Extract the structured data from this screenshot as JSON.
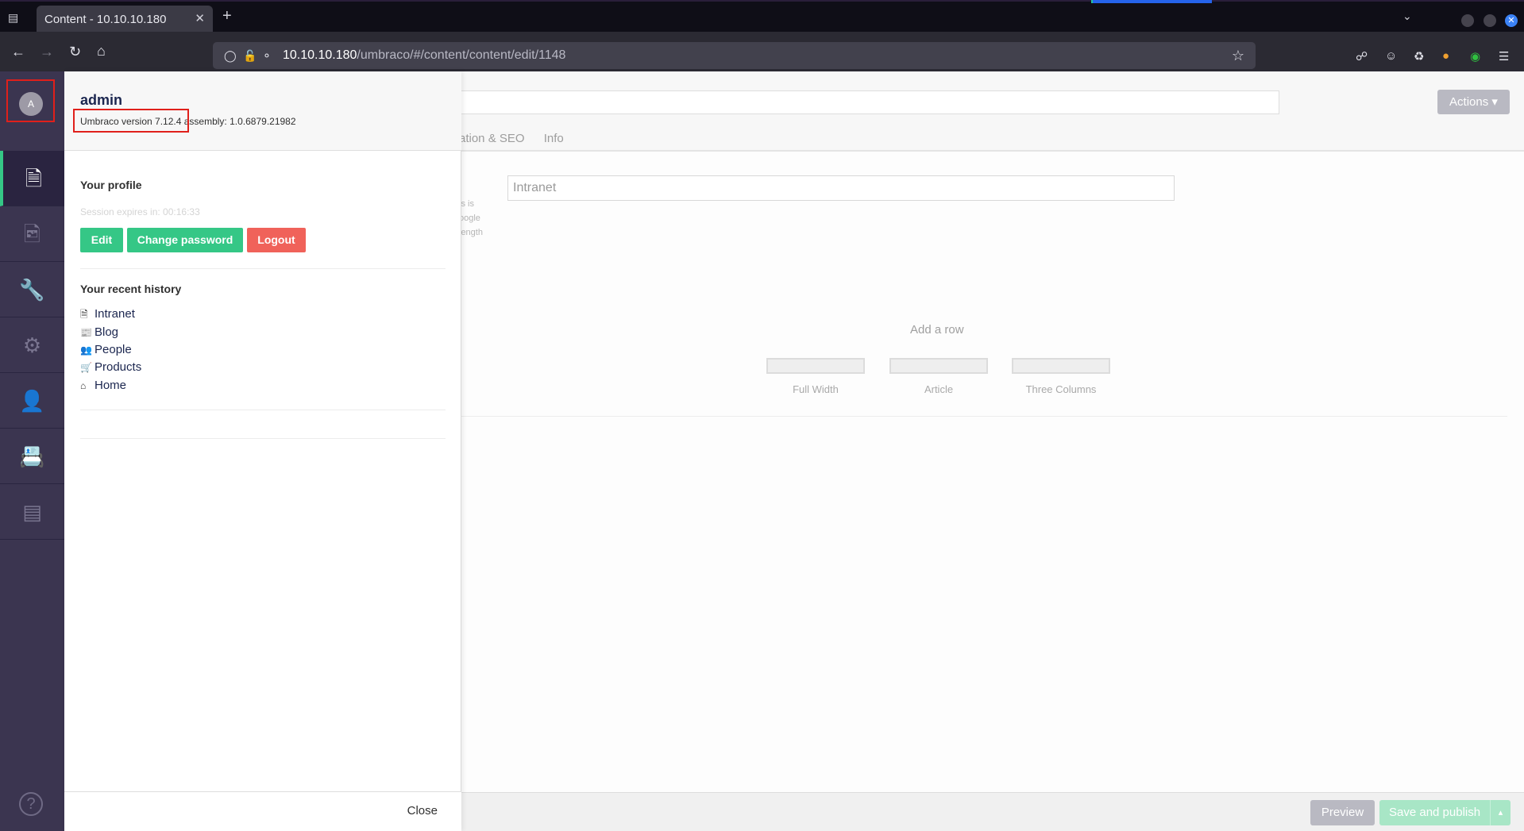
{
  "browser": {
    "tab_title": "Content - 10.10.10.180",
    "url_host": "10.10.10.180",
    "url_path": "/umbraco/#/content/content/edit/1148"
  },
  "sidebar": {
    "avatar_initial": "A",
    "sections": [
      {
        "name": "content",
        "icon": "document-icon"
      },
      {
        "name": "media",
        "icon": "image-icon"
      },
      {
        "name": "developer",
        "icon": "wrench-icon"
      },
      {
        "name": "settings",
        "icon": "gear-icon"
      },
      {
        "name": "users",
        "icon": "user-icon"
      },
      {
        "name": "members",
        "icon": "id-card-icon"
      },
      {
        "name": "forms",
        "icon": "forms-icon"
      }
    ]
  },
  "user_panel": {
    "name": "admin",
    "version": "Umbraco version 7.12.4",
    "assembly": "assembly: 1.0.6879.21982",
    "profile_heading": "Your profile",
    "session": "Session expires in: 00:16:33",
    "edit_label": "Edit",
    "change_password_label": "Change password",
    "logout_label": "Logout",
    "history_heading": "Your recent history",
    "history": [
      {
        "label": "Intranet",
        "icon": "document-icon"
      },
      {
        "label": "Blog",
        "icon": "newspaper-icon"
      },
      {
        "label": "People",
        "icon": "users-icon"
      },
      {
        "label": "Products",
        "icon": "cart-icon"
      },
      {
        "label": "Home",
        "icon": "home-icon"
      }
    ],
    "close_label": "Close"
  },
  "editor": {
    "actions_label": "Actions",
    "tabs": [
      "ation & SEO",
      "Info"
    ],
    "title_value": "Intranet",
    "description_fragments": [
      "is is",
      "oogle",
      "length"
    ],
    "add_row_label": "Add a row",
    "layouts": [
      "Full Width",
      "Article",
      "Three Columns"
    ],
    "preview_label": "Preview",
    "publish_label": "Save and publish"
  },
  "colors": {
    "accent_green": "#35c786",
    "danger_red": "#f0625a",
    "highlight_red": "#e0201b",
    "sidebar": "#3b3550"
  }
}
